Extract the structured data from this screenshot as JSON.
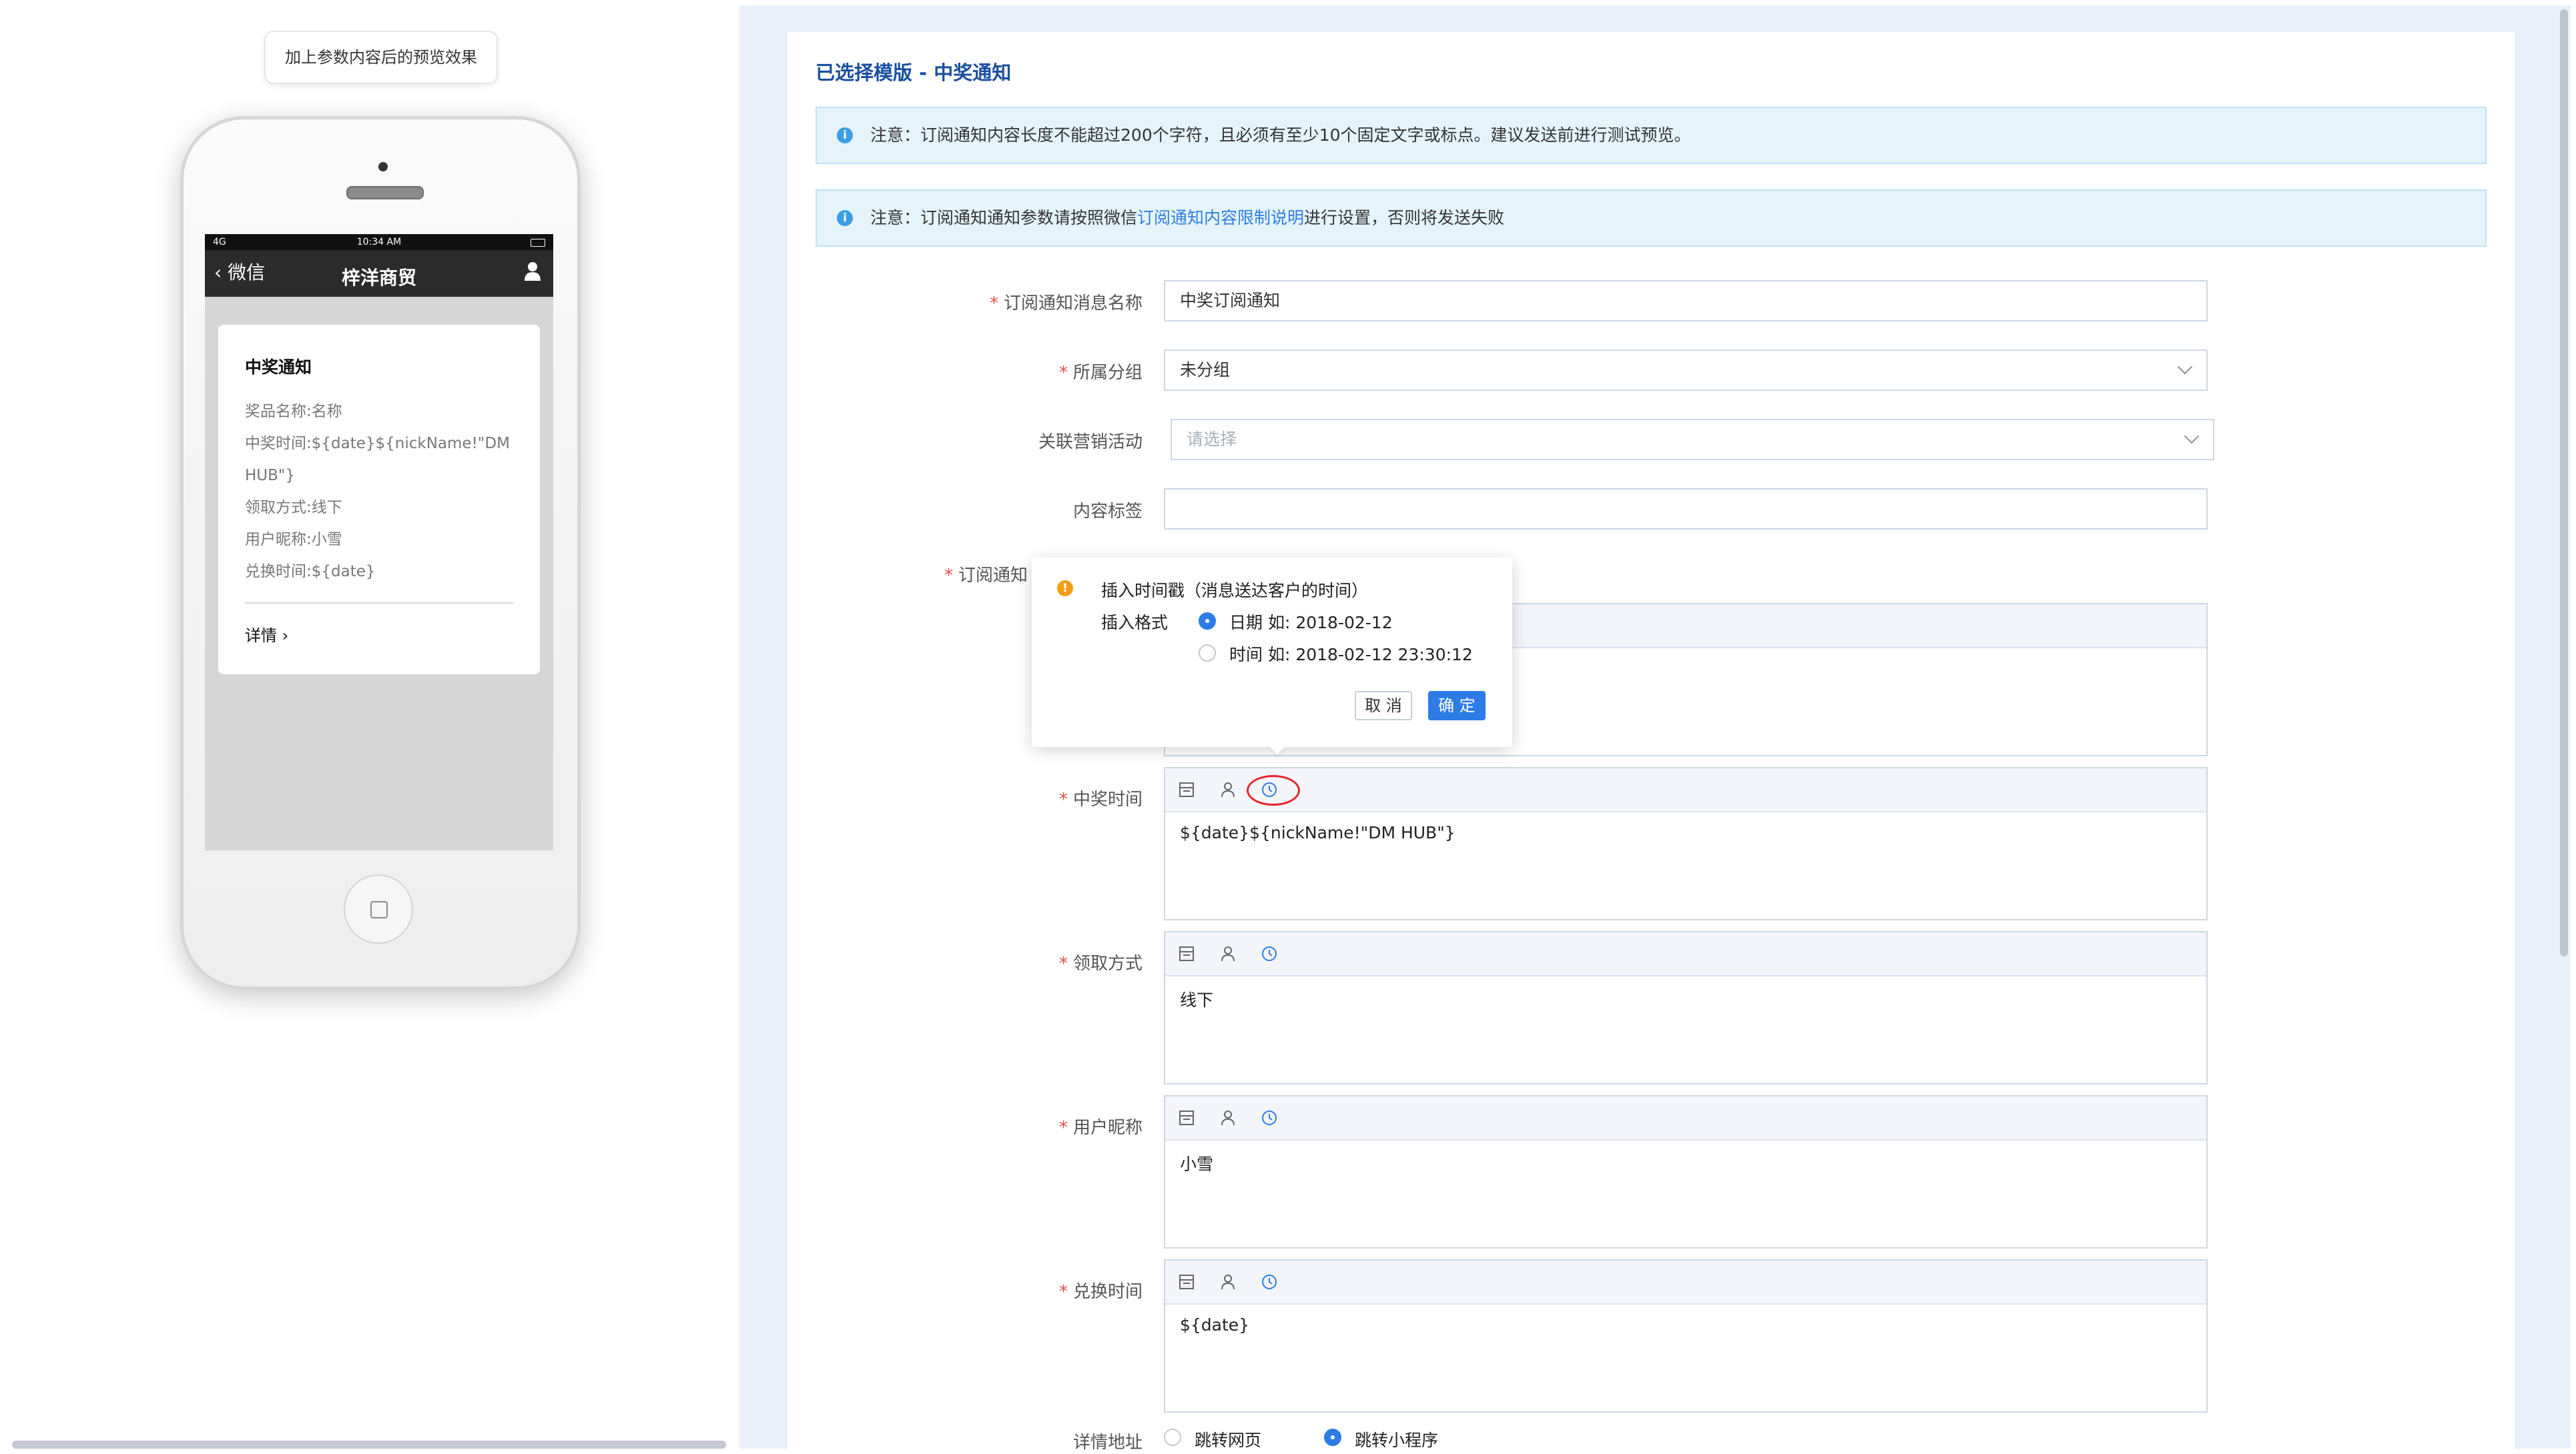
{
  "preview": {
    "tip": "加上参数内容后的预览效果",
    "status_bar": {
      "signal": "4G",
      "time": "10:34 AM"
    },
    "nav": {
      "back": "微信",
      "title": "梓洋商贸"
    },
    "message": {
      "title": "中奖通知",
      "lines": [
        "奖品名称:名称",
        "中奖时间:${date}${nickName!\"DM HUB\"}",
        "领取方式:线下",
        "用户昵称:小雪",
        "兑换时间:${date}"
      ],
      "detail": "详情"
    }
  },
  "form": {
    "heading": "已选择模版 - 中奖通知",
    "notices": [
      {
        "text": "注意：订阅通知内容长度不能超过200个字符，且必须有至少10个固定文字或标点。建议发送前进行测试预览。"
      },
      {
        "text_before": "注意：订阅通知通知参数请按照微信",
        "link": "订阅通知内容限制说明",
        "text_after": "进行设置，否则将发送失败"
      }
    ],
    "fields": {
      "name": {
        "label": "订阅通知消息名称",
        "value": "中奖订阅通知"
      },
      "group": {
        "label": "所属分组",
        "value": "未分组"
      },
      "campaign": {
        "label": "关联营销活动",
        "placeholder": "请选择"
      },
      "tag": {
        "label": "内容标签",
        "value": ""
      },
      "prize_name": {
        "label": "订阅通知"
      },
      "win_time": {
        "label": "中奖时间",
        "content": "${date}${nickName!\"DM HUB\"}"
      },
      "claim": {
        "label": "领取方式",
        "content": "线下"
      },
      "nickname": {
        "label": "用户昵称",
        "content": "小雪"
      },
      "redeem_time": {
        "label": "兑换时间",
        "content": "${date}"
      },
      "detail_link": {
        "label": "详情地址",
        "options": [
          "跳转网页",
          "跳转小程序"
        ],
        "selected": "跳转小程序"
      }
    },
    "required_mark": "*"
  },
  "popover": {
    "title": "插入时间戳（消息送达客户的时间）",
    "format_label": "插入格式",
    "options": [
      "日期 如: 2018-02-12",
      "时间 如: 2018-02-12 23:30:12"
    ],
    "selected": "日期 如: 2018-02-12",
    "cancel": "取 消",
    "ok": "确 定"
  },
  "colors": {
    "accent": "#2d7be5",
    "required": "#e34d4d",
    "notice_bg": "#e5f4fb",
    "highlight_ring": "#e12626"
  },
  "icons": [
    "field-icon",
    "user-icon",
    "clock-icon"
  ]
}
